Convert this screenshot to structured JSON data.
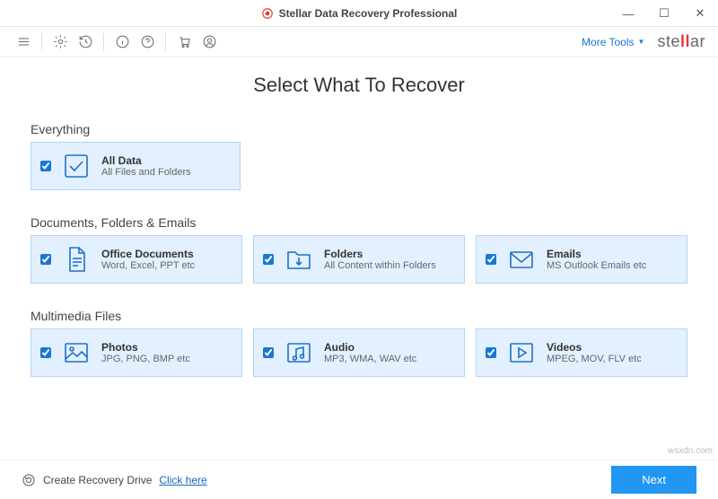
{
  "window": {
    "title": "Stellar Data Recovery Professional"
  },
  "toolbar": {
    "more_tools": "More Tools",
    "brand_pre": "ste",
    "brand_ll": "ll",
    "brand_post": "ar"
  },
  "page": {
    "title": "Select What To Recover"
  },
  "sections": {
    "everything": {
      "label": "Everything",
      "card": {
        "title": "All Data",
        "sub": "All Files and Folders"
      }
    },
    "docs": {
      "label": "Documents, Folders & Emails",
      "cards": [
        {
          "title": "Office Documents",
          "sub": "Word, Excel, PPT etc"
        },
        {
          "title": "Folders",
          "sub": "All Content within Folders"
        },
        {
          "title": "Emails",
          "sub": "MS Outlook Emails etc"
        }
      ]
    },
    "media": {
      "label": "Multimedia Files",
      "cards": [
        {
          "title": "Photos",
          "sub": "JPG, PNG, BMP etc"
        },
        {
          "title": "Audio",
          "sub": "MP3, WMA, WAV etc"
        },
        {
          "title": "Videos",
          "sub": "MPEG, MOV, FLV etc"
        }
      ]
    }
  },
  "footer": {
    "recovery_drive": "Create Recovery Drive",
    "click_here": "Click here",
    "next": "Next"
  },
  "watermark": "wsxdn.com"
}
